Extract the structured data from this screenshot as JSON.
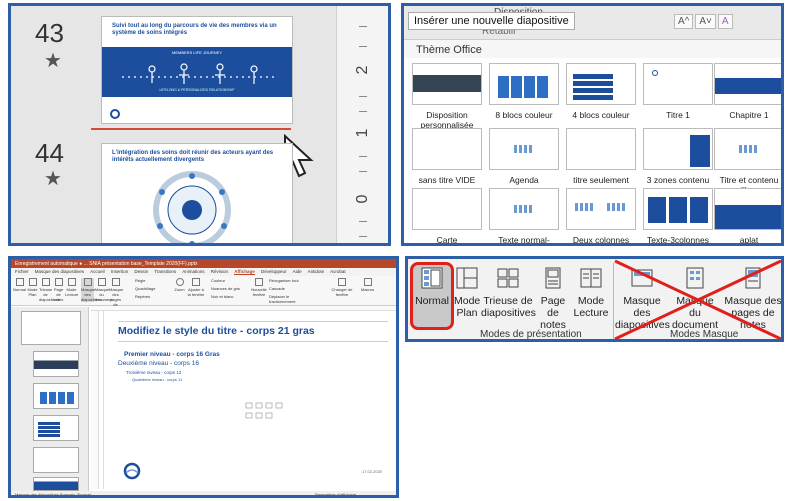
{
  "panel1": {
    "slides": [
      {
        "number": "43",
        "title": "Suivi tout au long du parcours de vie des membres via un système de soins intégrés",
        "banner": "MEMBERS LIFE JOURNEY",
        "subbanner": "LIFELONG & PERSONALIZED RELATIONSHIP"
      },
      {
        "number": "44",
        "title": "L'intégration des soins doit réunir des acteurs ayant des intérêts actuellement divergents"
      }
    ],
    "star_icon": "star-icon",
    "ruler_numbers": [
      "2",
      "1",
      "0"
    ]
  },
  "panel2": {
    "tooltip": "Insérer une nouvelle diapositive",
    "disposition_label": "Disposition",
    "retablir_label": "Rétablir",
    "theme_label": "Thème Office",
    "font_buttons": [
      "A^",
      "A˅",
      "A"
    ],
    "layouts": [
      "Disposition personnalisée",
      "8 blocs couleur",
      "4 blocs couleur",
      "Titre 1",
      "Chapitre 1",
      "sans titre VIDE",
      "Agenda",
      "titre seulement",
      "3 zones contenu",
      "Titre et contenu libre",
      "Carte",
      "Texte normal-2colonnes",
      "Deux colonnes normales",
      "Texte-3colonnes",
      "aplat"
    ]
  },
  "panel3": {
    "window_title": "Enregistrement automatique  ●  ...   SNIA présentation base_Template 2020(FF).pptx",
    "menu": [
      "Fichier",
      "Masque des diapositives",
      "Accueil",
      "Insertion",
      "Dessin",
      "Transitions",
      "Animations",
      "Révision",
      "Affichage",
      "Développeur",
      "Aide",
      "Antidote",
      "Acrobat"
    ],
    "active_menu": "Affichage",
    "ribbon_items": [
      "Normal",
      "Mode Plan",
      "Trieuse de diapositives",
      "Page de notes",
      "Mode Lecture",
      "Masque des diapositives",
      "Masque du document",
      "Masque des pages de notes",
      "Règle",
      "Quadrillage",
      "Repères",
      "Zoom",
      "Ajuster à la fenêtre",
      "Couleur",
      "Nuances de gris",
      "Noir et blanc",
      "Nouvelle fenêtre",
      "Réorganiser tout",
      "Cascade",
      "Déplacer le fractionnement",
      "Changer de fenêtre",
      "Macros"
    ],
    "slide_title": "Modifiez le style du titre - corps 21 gras",
    "level1": "Premier niveau - corps 16 Gras",
    "level2": "Deuxième niveau - corps 16",
    "level3": "Troisième niveau - corps 12",
    "level4": "Quatrième niveau - corps 11",
    "date_placeholder": "17.02.2020",
    "status_left": "Masque des diapositives   Français (France)",
    "status_right": "Paramètres d'affichage"
  },
  "panel4": {
    "buttons": [
      "Normal",
      "Mode Plan",
      "Trieuse de diapositives",
      "Page de notes",
      "Mode Lecture",
      "Masque des diapositives",
      "Masque du document",
      "Masque des pages de notes"
    ],
    "group_presentation": "Modes de présentation",
    "group_masque": "Modes Masque",
    "accent": "#e0201a"
  }
}
